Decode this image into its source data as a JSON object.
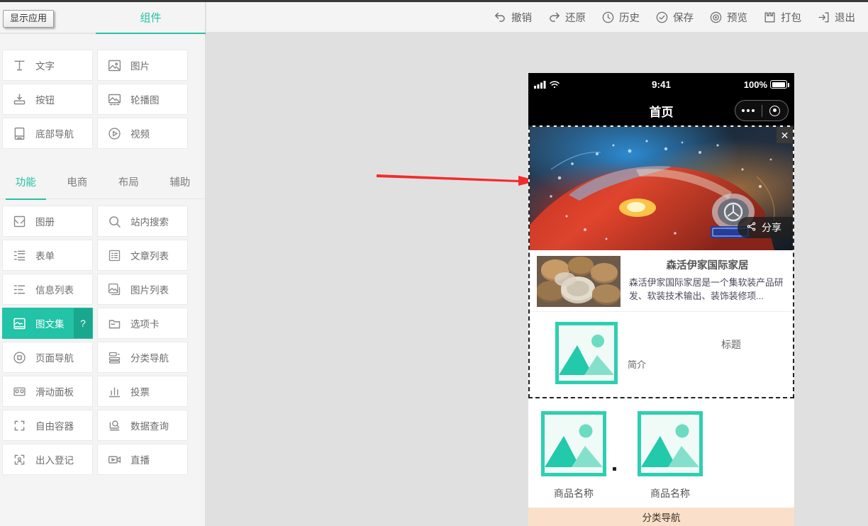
{
  "header": {
    "show_app_label": "显示应用",
    "panel_tab": "组件"
  },
  "toolbar": {
    "items": [
      {
        "label": "撤销",
        "icon": "undo-icon"
      },
      {
        "label": "还原",
        "icon": "redo-icon"
      },
      {
        "label": "历史",
        "icon": "clock-icon"
      },
      {
        "label": "保存",
        "icon": "check-circle-icon"
      },
      {
        "label": "预览",
        "icon": "eye-target-icon"
      },
      {
        "label": "打包",
        "icon": "package-icon"
      },
      {
        "label": "退出",
        "icon": "exit-icon"
      }
    ]
  },
  "sidebar": {
    "basic_components": [
      {
        "label": "文字",
        "icon": "text-icon"
      },
      {
        "label": "图片",
        "icon": "image-icon"
      },
      {
        "label": "按钮",
        "icon": "button-icon"
      },
      {
        "label": "轮播图",
        "icon": "carousel-icon"
      },
      {
        "label": "底部导航",
        "icon": "bottom-nav-icon"
      },
      {
        "label": "视频",
        "icon": "video-play-icon"
      }
    ],
    "category_tabs": [
      {
        "label": "功能",
        "active": true
      },
      {
        "label": "电商",
        "active": false
      },
      {
        "label": "布局",
        "active": false
      },
      {
        "label": "辅助",
        "active": false
      }
    ],
    "function_components": [
      {
        "label": "图册",
        "icon": "album-icon",
        "active": false,
        "badge": ""
      },
      {
        "label": "站内搜索",
        "icon": "search-icon",
        "active": false,
        "badge": ""
      },
      {
        "label": "表单",
        "icon": "form-icon",
        "active": false,
        "badge": ""
      },
      {
        "label": "文章列表",
        "icon": "article-list-icon",
        "active": false,
        "badge": ""
      },
      {
        "label": "信息列表",
        "icon": "info-list-icon",
        "active": false,
        "badge": ""
      },
      {
        "label": "图片列表",
        "icon": "image-list-icon",
        "active": false,
        "badge": ""
      },
      {
        "label": "图文集",
        "icon": "gallery-icon",
        "active": true,
        "badge": "?"
      },
      {
        "label": "选项卡",
        "icon": "tab-card-icon",
        "active": false,
        "badge": ""
      },
      {
        "label": "页面导航",
        "icon": "page-nav-icon",
        "active": false,
        "badge": ""
      },
      {
        "label": "分类导航",
        "icon": "category-nav-icon",
        "active": false,
        "badge": ""
      },
      {
        "label": "滑动面板",
        "icon": "slide-panel-icon",
        "active": false,
        "badge": ""
      },
      {
        "label": "投票",
        "icon": "poll-chart-icon",
        "active": false,
        "badge": ""
      },
      {
        "label": "自由容器",
        "icon": "free-container-icon",
        "active": false,
        "badge": ""
      },
      {
        "label": "数据查询",
        "icon": "data-query-icon",
        "active": false,
        "badge": ""
      },
      {
        "label": "出入登记",
        "icon": "checkin-icon",
        "active": false,
        "badge": ""
      },
      {
        "label": "直播",
        "icon": "live-stream-icon",
        "active": false,
        "badge": ""
      }
    ]
  },
  "preview": {
    "status_bar": {
      "time": "9:41",
      "battery": "100%"
    },
    "nav_title": "首页",
    "banner": {
      "close_label": "✕",
      "share_label": "分享"
    },
    "article_card": {
      "title": "森活伊家国际家居",
      "desc": "森活伊家国际家居是一个集软装产品研发、软装技术输出、装饰装修项..."
    },
    "placeholder_item": {
      "title": "标题",
      "subtitle": "简介"
    },
    "products": [
      {
        "name": "商品名称"
      },
      {
        "name": "商品名称"
      }
    ],
    "bottom_nav_label": "分类导航",
    "service_button": "customer-service-icon"
  },
  "colors": {
    "accent": "#22c3a6",
    "accent_dark": "#19a78d",
    "placeholder": "#2ecfb0",
    "annotation_arrow": "#f32b2b",
    "bottom_nav_bg": "#fae0ca",
    "service_bubble": "#d94f3d",
    "canvas_bg": "#e0e0e0",
    "panel_bg": "#f4f4f4"
  }
}
